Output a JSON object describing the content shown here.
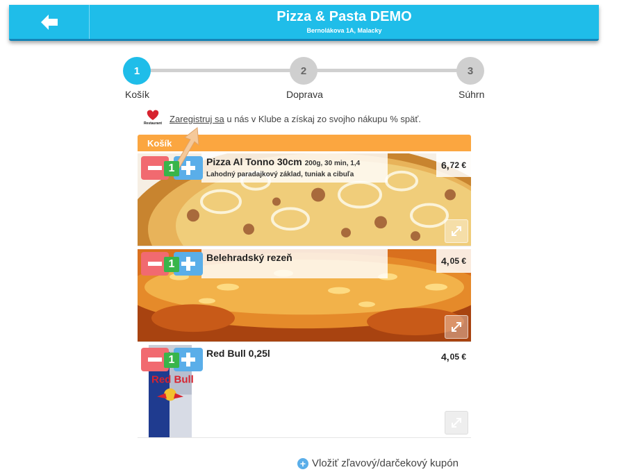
{
  "header": {
    "title": "Pizza & Pasta DEMO",
    "subtitle": "Bernolákova 1A, Malacky",
    "back_icon": "arrow-left-icon"
  },
  "steps": [
    {
      "number": "1",
      "label": "Košík",
      "state": "active"
    },
    {
      "number": "2",
      "label": "Doprava",
      "state": "inactive"
    },
    {
      "number": "3",
      "label": "Súhrn",
      "state": "inactive"
    }
  ],
  "register": {
    "logo_text": "Restaurant",
    "link": "Zaregistruj sa",
    "text": " u nás v Klube a získaj zo svojho nákupu % späť."
  },
  "cart": {
    "header": "Košík",
    "items": [
      {
        "name": "Pizza Al Tonno 30cm",
        "meta": "200g, 30 min, 1,4",
        "description": "Lahodný paradajkový základ, tuniak a cibuľa",
        "price_int": "6,",
        "price_dec": "72 €",
        "quantity": "1"
      },
      {
        "name": "Belehradský rezeň",
        "meta": "",
        "description": "",
        "price_int": "4,",
        "price_dec": "05 €",
        "quantity": "1"
      },
      {
        "name": "Red Bull 0,25l",
        "meta": "",
        "description": "",
        "price_int": "4,",
        "price_dec": "05 €",
        "quantity": "1"
      }
    ]
  },
  "coupon": {
    "label": "Vložiť zľavový/darčekový kupón"
  },
  "colors": {
    "accent": "#1fbde9",
    "cart_header": "#fba640",
    "minus": "#f16a70",
    "plus": "#5aaee9",
    "qty": "#39b54a"
  }
}
